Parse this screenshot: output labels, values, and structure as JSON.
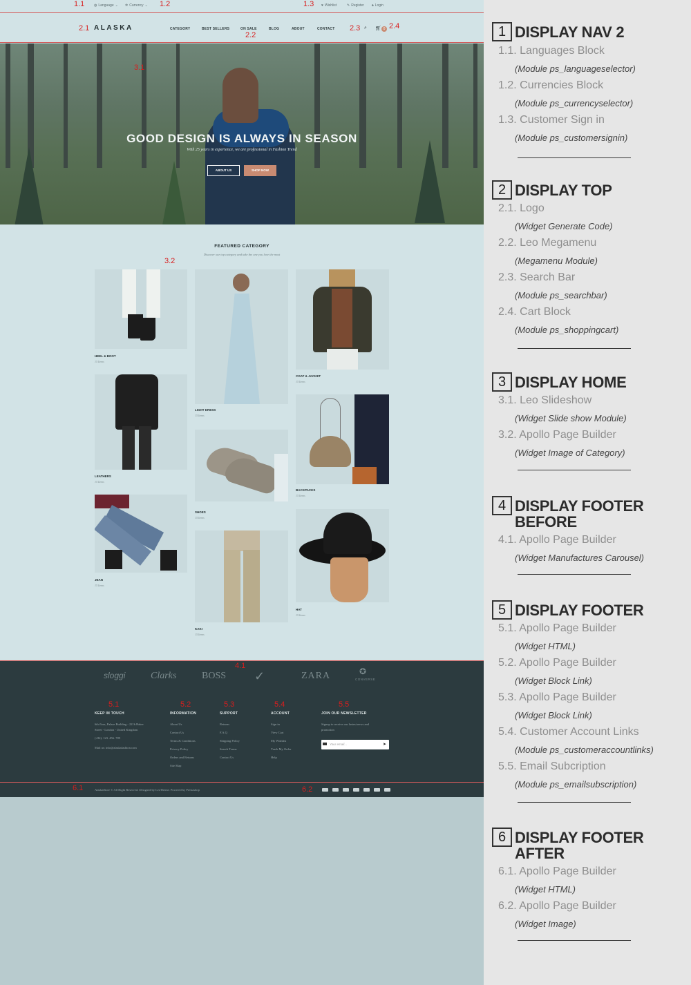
{
  "markers": [
    "1.1",
    "1.2",
    "1.3",
    "2.1",
    "2.2",
    "2.3",
    "2.4",
    "3.1",
    "3.2",
    "4.1",
    "5.1",
    "5.2",
    "5.3",
    "5.4",
    "5.5",
    "6.1",
    "6.2"
  ],
  "nav2": {
    "language": "Language",
    "currency": "Currency",
    "wishlist": "Wishlist",
    "register": "Register",
    "login": "Login"
  },
  "top": {
    "logo": "ALASKA",
    "menu": [
      "CATEGORY",
      "BEST SELLERS",
      "ON SALE",
      "BLOG",
      "ABOUT",
      "CONTACT"
    ],
    "cart_count": "0"
  },
  "hero": {
    "title": "GOOD DESIGN IS ALWAYS IN SEASON",
    "subtitle": "With 25 years in experience, we are professional in Fashion Trend",
    "btn_about": "ABOUT US",
    "btn_shop": "SHOP NOW"
  },
  "featured": {
    "title": "FEATURED CATEGORY",
    "subtitle": "Discover our top category and take the one you love the most",
    "categories": [
      {
        "name": "HEEL & BOOT",
        "count": "15 Items"
      },
      {
        "name": "LEATHERS",
        "count": "15 Items"
      },
      {
        "name": "JEAN",
        "count": "15 Items"
      },
      {
        "name": "LIGHT DRESS",
        "count": "15 Items"
      },
      {
        "name": "SHOES",
        "count": "15 Items"
      },
      {
        "name": "KAKI",
        "count": "15 Items"
      },
      {
        "name": "COAT & JACKET",
        "count": "15 Items"
      },
      {
        "name": "BACKPACKS",
        "count": "15 Items"
      },
      {
        "name": "HAT",
        "count": "15 Items"
      }
    ]
  },
  "brands": [
    "sloggi",
    "Clarks",
    "BOSS",
    "ZARA",
    "CONVERSE"
  ],
  "footer": {
    "keep": {
      "title": "KEEP IN TOUCH",
      "lines": [
        "6th floor, Palace Building - 221b Baker",
        "Street - London - United Kingdom",
        "(+84). 123. 456. 789",
        "Mail us: info@alaskafashion.com"
      ]
    },
    "info": {
      "title": "INFORMATION",
      "links": [
        "About Us",
        "Contact Us",
        "Terms & Conditions",
        "Privacy Policy",
        "Orders and Returns",
        "Site Map"
      ]
    },
    "support": {
      "title": "SUPPORT",
      "links": [
        "Returns",
        "F.A.Q",
        "Shipping Policy",
        "Search Terms",
        "Contact Us"
      ]
    },
    "account": {
      "title": "ACCOUNT",
      "links": [
        "Sign in",
        "View Cart",
        "My Wishlist",
        "Track My Order",
        "Help"
      ]
    },
    "newsletter": {
      "title": "JOIN OUR NEWSLETTER",
      "text1": "Signup to receive our lastest news and",
      "text2": "promotion",
      "placeholder": "Your email..."
    },
    "copyright": "AlaskaStore © All Right Reserved. Designed by LeoTheme. Powered by Prestashop"
  },
  "legend": [
    {
      "num": "1",
      "title": "DISPLAY NAV 2",
      "items": [
        {
          "label": "1.1. Languages Block",
          "sub": "(Module ps_languageselector)"
        },
        {
          "label": "1.2. Currencies Block",
          "sub": "(Module ps_currencyselector)"
        },
        {
          "label": "1.3. Customer Sign in",
          "sub": "(Module ps_customersignin)"
        }
      ]
    },
    {
      "num": "2",
      "title": "DISPLAY TOP",
      "items": [
        {
          "label": "2.1. Logo",
          "sub": "(Widget Generate Code)"
        },
        {
          "label": "2.2. Leo Megamenu",
          "sub": "(Megamenu Module)"
        },
        {
          "label": "2.3. Search Bar",
          "sub": "(Module ps_searchbar)"
        },
        {
          "label": "2.4. Cart Block",
          "sub": "(Module ps_shoppingcart)"
        }
      ]
    },
    {
      "num": "3",
      "title": "DISPLAY HOME",
      "items": [
        {
          "label": "3.1. Leo Slideshow",
          "sub": "(Widget Slide show Module)"
        },
        {
          "label": "3.2. Apollo Page Builder",
          "sub": "(Widget Image of Category)"
        }
      ]
    },
    {
      "num": "4",
      "title": "DISPLAY FOOTER",
      "title2": "BEFORE",
      "items": [
        {
          "label": "4.1. Apollo Page Builder",
          "sub": "(Widget Manufactures Carousel)"
        }
      ]
    },
    {
      "num": "5",
      "title": "DISPLAY FOOTER",
      "items": [
        {
          "label": "5.1. Apollo Page Builder",
          "sub": "(Widget HTML)"
        },
        {
          "label": "5.2. Apollo Page Builder",
          "sub": "(Widget Block Link)"
        },
        {
          "label": "5.3. Apollo Page Builder",
          "sub": "(Widget Block Link)"
        },
        {
          "label": "5.4. Customer Account Links",
          "sub": "(Module ps_customeraccountlinks)"
        },
        {
          "label": "5.5. Email Subcription",
          "sub": "(Module ps_emailsubscription)"
        }
      ]
    },
    {
      "num": "6",
      "title": "DISPLAY FOOTER",
      "title2": "AFTER",
      "items": [
        {
          "label": "6.1. Apollo Page Builder",
          "sub": "(Widget HTML)"
        },
        {
          "label": "6.2. Apollo Page Builder",
          "sub": "(Widget Image)"
        }
      ]
    }
  ]
}
